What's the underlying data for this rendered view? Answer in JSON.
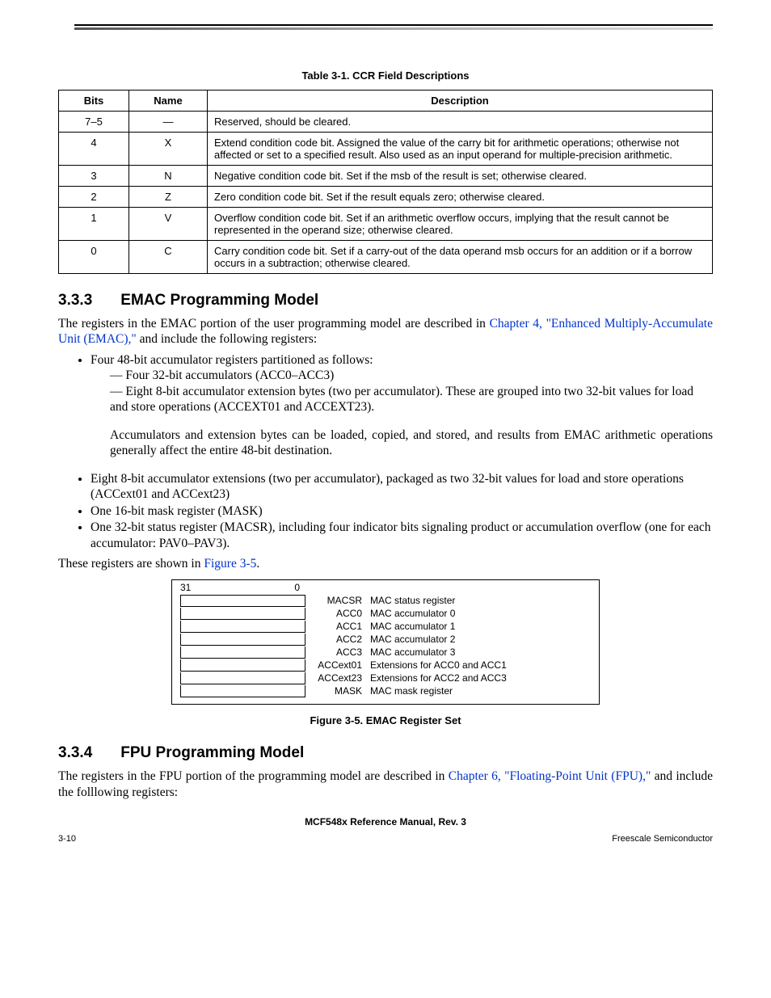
{
  "table1": {
    "caption": "Table 3-1. CCR Field Descriptions",
    "headers": {
      "bits": "Bits",
      "name": "Name",
      "desc": "Description"
    },
    "rows": [
      {
        "bits": "7–5",
        "name": "—",
        "desc": "Reserved, should be cleared."
      },
      {
        "bits": "4",
        "name": "X",
        "desc": "Extend condition code bit. Assigned the value of the carry bit for arithmetic operations; otherwise not affected or set to a specified result. Also used as an input operand for multiple-precision arithmetic."
      },
      {
        "bits": "3",
        "name": "N",
        "desc": "Negative condition code bit. Set if the msb of the result is set; otherwise cleared."
      },
      {
        "bits": "2",
        "name": "Z",
        "desc": "Zero condition code bit. Set if the result equals zero; otherwise cleared."
      },
      {
        "bits": "1",
        "name": "V",
        "desc": "Overflow condition code bit. Set if an arithmetic overflow occurs, implying that the result cannot be represented in the operand size; otherwise cleared."
      },
      {
        "bits": "0",
        "name": "C",
        "desc": "Carry condition code bit. Set if a carry-out of the data operand msb occurs for an addition or if a borrow occurs in a subtraction; otherwise cleared."
      }
    ]
  },
  "section333": {
    "number": "3.3.3",
    "title": "EMAC Programming Model",
    "para1_pre": "The registers in the EMAC portion of the user programming model are described in ",
    "para1_link": "Chapter 4, \"Enhanced Multiply-Accumulate Unit (EMAC),\"",
    "para1_post": " and include the following registers:",
    "bullet1": "Four 48-bit accumulator registers partitioned as follows:",
    "bullet1a": "Four 32-bit accumulators (ACC0–ACC3)",
    "bullet1b": "Eight 8-bit accumulator extension bytes (two per accumulator). These are grouped into two 32-bit values for load and store operations (ACCEXT01 and ACCEXT23).",
    "subtext": "Accumulators and extension bytes can be loaded, copied, and stored, and results from EMAC arithmetic operations generally affect the entire 48-bit destination.",
    "bullet2": "Eight 8-bit accumulator extensions (two per accumulator), packaged as two 32-bit values for load and store operations (ACCext01 and ACCext23)",
    "bullet3": "One 16-bit mask register (MASK)",
    "bullet4": "One 32-bit status register (MACSR), including four indicator bits signaling product or accumulation overflow (one for each accumulator: PAV0–PAV3).",
    "para2_pre": "These registers are shown in ",
    "para2_link": "Figure 3-5",
    "para2_post": "."
  },
  "figure35": {
    "hdr31": "31",
    "hdr0": "0",
    "rows": [
      {
        "name": "MACSR",
        "desc": "MAC status register"
      },
      {
        "name": "ACC0",
        "desc": "MAC accumulator 0"
      },
      {
        "name": "ACC1",
        "desc": "MAC accumulator 1"
      },
      {
        "name": "ACC2",
        "desc": "MAC accumulator 2"
      },
      {
        "name": "ACC3",
        "desc": "MAC accumulator 3"
      },
      {
        "name": "ACCext01",
        "desc": "Extensions for ACC0 and ACC1"
      },
      {
        "name": "ACCext23",
        "desc": "Extensions for ACC2 and ACC3"
      },
      {
        "name": "MASK",
        "desc": "MAC mask register"
      }
    ],
    "caption": "Figure 3-5. EMAC Register Set"
  },
  "section334": {
    "number": "3.3.4",
    "title": "FPU Programming Model",
    "para1_pre": "The registers in the FPU portion of the programming model are described in ",
    "para1_link": "Chapter 6, \"Floating-Point Unit (FPU),\"",
    "para1_post": " and include the folllowing registers:"
  },
  "footer": {
    "title": "MCF548x Reference Manual, Rev. 3",
    "left": "3-10",
    "right": "Freescale Semiconductor"
  }
}
